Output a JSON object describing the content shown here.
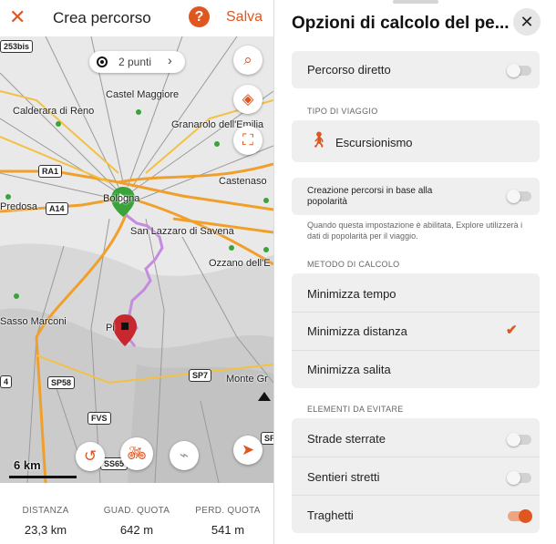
{
  "header": {
    "close_icon": "close-icon",
    "title": "Crea percorso",
    "help_label": "?",
    "save_label": "Salva"
  },
  "map": {
    "points_label": "2 punti",
    "labels": {
      "castel_maggiore": "Castel Maggiore",
      "calderara": "Calderara di Reno",
      "granarolo": "Granarolo dell'Emilia",
      "castenaso": "Castenaso",
      "predosa": "Predosa",
      "bologna": "Bologna",
      "san_lazzaro": "San Lazzaro di Savena",
      "ozzano": "Ozzano dell'E",
      "sasso_marconi": "Sasso Marconi",
      "pianoro": "Pi",
      "monte": "Monte Gr"
    },
    "shields": {
      "s253bis": "253bis",
      "ra1": "RA1",
      "a14": "A14",
      "sp58": "SP58",
      "sp7": "SP7",
      "fvs": "FVS",
      "ss65": "SS65",
      "s4": "4",
      "sp": "SP"
    },
    "scale_label": "6 km",
    "route_color": "#c48be0",
    "start_color": "#3aa43a",
    "end_color": "#c7282e"
  },
  "stats": {
    "distance": {
      "label": "DISTANZA",
      "value": "23,3 km"
    },
    "ascent": {
      "label": "GUAD. QUOTA",
      "value": "642 m"
    },
    "descent": {
      "label": "PERD. QUOTA",
      "value": "541 m"
    }
  },
  "options": {
    "title": "Opzioni di calcolo del pe...",
    "direct_route": "Percorso diretto",
    "travel_type_header": "TIPO DI VIAGGIO",
    "travel_type": "Escursionismo",
    "popularity_label": "Creazione percorsi in base alla popolarità",
    "popularity_note": "Quando questa impostazione è abilitata, Explore utilizzerà i dati di popolarità per il viaggio.",
    "method_header": "METODO DI CALCOLO",
    "methods": [
      "Minimizza tempo",
      "Minimizza distanza",
      "Minimizza salita"
    ],
    "avoid_header": "ELEMENTI DA EVITARE",
    "avoid": [
      "Strade sterrate",
      "Sentieri stretti",
      "Traghetti"
    ],
    "accent": "#e0561f"
  }
}
